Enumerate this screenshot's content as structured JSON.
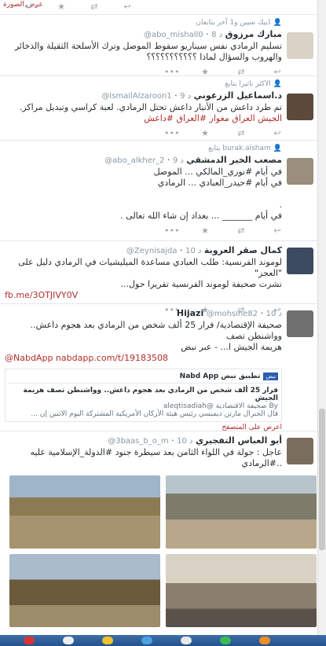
{
  "top": {
    "link": "عرض الصورة"
  },
  "tweets": [
    {
      "context": "دُبيك سبين و1 آخر يتابعان",
      "name": "مبارك مرزوق",
      "handle": "@abo_mishall0",
      "time": "8 د",
      "lines": [
        "تسليم الرمادي نفس سيناريو سقوط الموصل وترك الأسلحة الثقيلة والذخائر",
        "والهروب والسؤال لماذا ؟؟؟؟؟؟؟؟؟؟؟"
      ]
    },
    {
      "context": "الاكثر تاثيرا يتابع",
      "name": "د.اسماعيل الزرعوني",
      "handle": "@IsmailAlzaroon1",
      "time": "9 د",
      "lines": [
        "تم طرد داعش من الأنبار داعش تحتل الرمادي. لعبة كراسي وتبديل مراكز.",
        "الجيش العراق مغوار #العراق #داعش"
      ]
    },
    {
      "context": "burak.alsham يتابع",
      "name": "مصعب الخير الدمشقي",
      "handle": "@abo_alkher_2",
      "time": "9 د",
      "lines": [
        "في أيام #نوري_المالكي ... الموصل",
        "في أيام #حيدر_العبادي ... الرمادي",
        ".",
        "في أيام _______ ... بغداد إن شاء الله تعالى ."
      ]
    },
    {
      "context": "",
      "name": "كمال صقر العروبة",
      "handle": "@Zeynisajda",
      "time": "10 د",
      "lines": [
        "لوموند الفرنسية: طلب العبادي مساعدة الميليشيات في الرمادي دليل على \"العجز\"",
        "نشرت صحيفة لوموند الفرنسية تقريرا حول...",
        "fb.me/3OTJIVY0V"
      ]
    },
    {
      "context": "",
      "name": "Hijazi",
      "handle": "@mohsine82",
      "time": "10 د",
      "lines": [
        "صحيفة الإقتصادية/ فرار 25 ألف شخص من الرمادي بعد هجوم داعش.. وواشنطن تصف",
        "هزيمة الجيش ا... - عبر نبض",
        "@NabdApp nabdapp.com/t/19183508"
      ],
      "card": {
        "app": "تطبيق نبض Nabd App",
        "badge": "نبض",
        "title": "فرار 25 ألف شخص من الرمادي بعد هجوم داعش.. وواشنطن تصف هزيمة الجيش",
        "by": "By صحيفة الاقتصادية @aleqtisadiah",
        "body": "قال الجنرال مارتن ديمبسي رئيس هيئة الأركان الأمريكية المشتركة اليوم الاثنين إن ..."
      },
      "summary": "اعرض على المتصفح"
    },
    {
      "context": "",
      "name": "أبو العباس التفجيري",
      "handle": "@3baas_b_o_m",
      "time": "10 د",
      "lines": [
        "عاجل : جولة في اللواء الثامن بعد سيطرة جنود #الدولة_الإسلامية عليه ..#الرمادي"
      ]
    }
  ]
}
